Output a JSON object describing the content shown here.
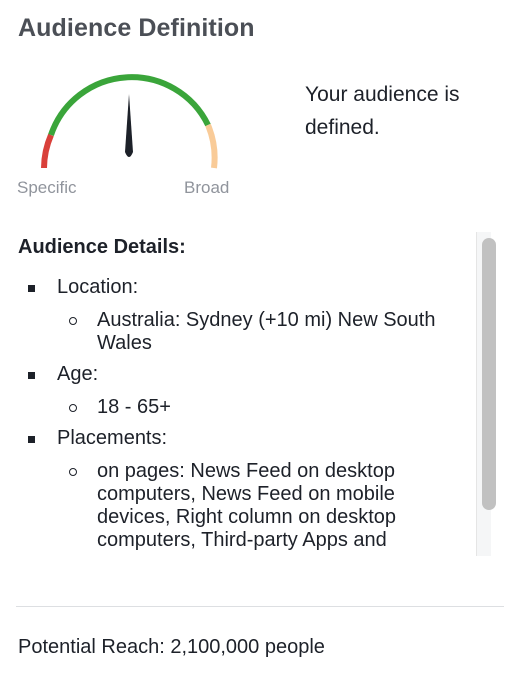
{
  "title": "Audience Definition",
  "gauge": {
    "label_left": "Specific",
    "label_right": "Broad",
    "colors": {
      "specific": "#d9403a",
      "defined": "#3aa53a",
      "broad": "#f9cb98",
      "needle": "#1d2129"
    }
  },
  "status_text": "Your audience is defined.",
  "details": {
    "heading": "Audience Details:",
    "items": [
      {
        "label": "Location:",
        "values": [
          "Australia: Sydney (+10 mi) New South Wales"
        ]
      },
      {
        "label": "Age:",
        "values": [
          "18 - 65+"
        ]
      },
      {
        "label": "Placements:",
        "values": [
          "on pages: News Feed on desktop computers, News Feed on mobile devices, Right column on desktop computers, Third-party Apps and"
        ]
      }
    ]
  },
  "reach_text": "Potential Reach: 2,100,000 people"
}
